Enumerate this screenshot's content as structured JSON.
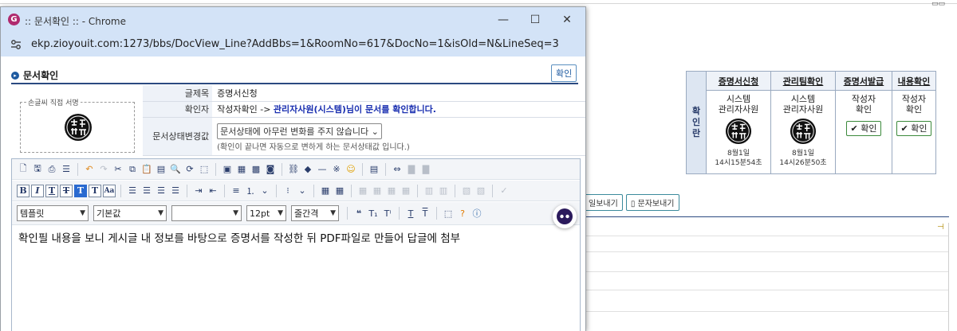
{
  "window": {
    "title": ":: 문서확인 :: - Chrome",
    "app_icon": "G",
    "url": "ekp.zioyouit.com:1273/bbs/DocView_Line?AddBbs=1&RoomNo=617&DocNo=1&isOld=N&LineSeq=3",
    "minimize_glyph": "—",
    "maximize_glyph": "☐",
    "close_glyph": "✕"
  },
  "doc": {
    "heading": "문서확인",
    "confirm_label": "확인",
    "sign_legend": "손글씨 직접 서명",
    "rows": {
      "title_label": "글제목",
      "title_value": "증명서신청",
      "confirmer_label": "확인자",
      "confirmer_prefix": "작성자확인 -> ",
      "confirmer_highlight": "관리자사원(시스템)님이 문서를 확인합니다.",
      "status_label": "문서상태변경값",
      "status_select": "문서상태에 아무런 변화를 주지 않습니다",
      "status_hint": "(확인이 끝나면 자동으로 변하게 하는 문서상태값 입니다.)"
    }
  },
  "editor": {
    "dropdowns": {
      "template": "템플릿",
      "font": "기본값",
      "blank": "",
      "size": "12pt",
      "line_height": "줄간격"
    },
    "body": "확인필 내용을 보니 게시글 내 정보를 바탕으로 증명서를 작성한 뒤 PDF파일로 만들어 답글에 첨부"
  },
  "approval": {
    "side_label": [
      "확",
      "인",
      "란"
    ],
    "columns": [
      {
        "header": "증명서신청",
        "line1": "시스템",
        "line2": "관리자사원",
        "date": "8월1일",
        "time": "14시15분54초"
      },
      {
        "header": "관리팀확인",
        "line1": "시스템",
        "line2": "관리자사원",
        "date": "8월1일",
        "time": "14시26분50초"
      },
      {
        "header": "증명서발급",
        "line1": "작성자",
        "line2": "확인",
        "button": "확인"
      },
      {
        "header": "내용확인",
        "line1": "작성자",
        "line2": "확인",
        "button": "확인"
      }
    ]
  },
  "background_buttons": [
    "일보내기",
    "문자보내기"
  ],
  "colors": {
    "titlebar": "#d3e3f7",
    "accent_navy": "#2b4a80",
    "highlight_blue": "#1a2fb0",
    "label_bg": "#eef2f8"
  }
}
